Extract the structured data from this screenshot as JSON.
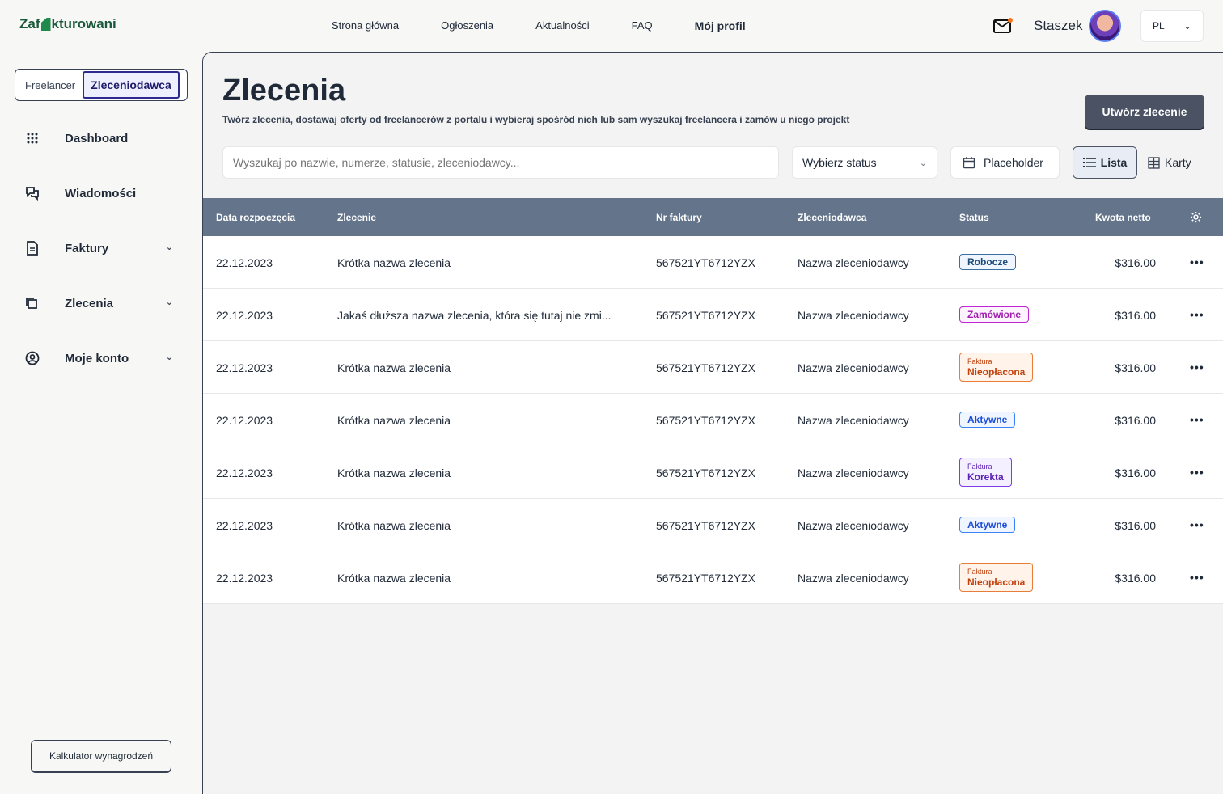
{
  "brand": {
    "logo_left": "Zaf",
    "logo_right": "kturowani"
  },
  "nav": {
    "items": [
      "Strona główna",
      "Ogłoszenia",
      "Aktualności",
      "FAQ"
    ],
    "profile": "Mój profil"
  },
  "user": {
    "name": "Staszek"
  },
  "lang": {
    "value": "PL"
  },
  "sidebar": {
    "role_freelancer": "Freelancer",
    "role_client": "Zleceniodawca",
    "items": [
      {
        "label": "Dashboard"
      },
      {
        "label": "Wiadomości"
      },
      {
        "label": "Faktury"
      },
      {
        "label": "Zlecenia"
      },
      {
        "label": "Moje konto"
      }
    ],
    "calculator": "Kalkulator wynagrodzeń"
  },
  "page": {
    "title": "Zlecenia",
    "subtitle": "Twórz zlecenia, dostawaj oferty od freelancerów z portalu i wybieraj spośród nich lub sam wyszukaj freelancera i zamów u niego projekt",
    "create_button": "Utwórz zlecenie"
  },
  "filters": {
    "search_placeholder": "Wyszukaj po nazwie, numerze, statusie, zleceniodawcy...",
    "status_label": "Wybierz status",
    "date_label": "Placeholder",
    "view_list": "Lista",
    "view_cards": "Karty"
  },
  "table": {
    "headers": {
      "date": "Data rozpoczęcia",
      "order": "Zlecenie",
      "invoice": "Nr faktury",
      "client": "Zleceniodawca",
      "status": "Status",
      "amount": "Kwota netto"
    },
    "rows": [
      {
        "date": "22.12.2023",
        "name": "Krótka nazwa zlecenia",
        "invoice": "567521YT6712YZX",
        "client": "Nazwa zleceniodawcy",
        "status_top": "",
        "status": "Robocze",
        "amount": "$316.00"
      },
      {
        "date": "22.12.2023",
        "name": "Jakaś dłuższa nazwa zlecenia, która się tutaj nie zmi...",
        "invoice": "567521YT6712YZX",
        "client": "Nazwa zleceniodawcy",
        "status_top": "",
        "status": "Zamówione",
        "amount": "$316.00"
      },
      {
        "date": "22.12.2023",
        "name": "Krótka nazwa zlecenia",
        "invoice": "567521YT6712YZX",
        "client": "Nazwa zleceniodawcy",
        "status_top": "Faktura",
        "status": "Nieopłacona",
        "amount": "$316.00"
      },
      {
        "date": "22.12.2023",
        "name": "Krótka nazwa zlecenia",
        "invoice": "567521YT6712YZX",
        "client": "Nazwa zleceniodawcy",
        "status_top": "",
        "status": "Aktywne",
        "amount": "$316.00"
      },
      {
        "date": "22.12.2023",
        "name": "Krótka nazwa zlecenia",
        "invoice": "567521YT6712YZX",
        "client": "Nazwa zleceniodawcy",
        "status_top": "Faktura",
        "status": "Korekta",
        "amount": "$316.00"
      },
      {
        "date": "22.12.2023",
        "name": "Krótka nazwa zlecenia",
        "invoice": "567521YT6712YZX",
        "client": "Nazwa zleceniodawcy",
        "status_top": "",
        "status": "Aktywne",
        "amount": "$316.00"
      },
      {
        "date": "22.12.2023",
        "name": "Krótka nazwa zlecenia",
        "invoice": "567521YT6712YZX",
        "client": "Nazwa zleceniodawcy",
        "status_top": "Faktura",
        "status": "Nieopłacona",
        "amount": "$316.00"
      }
    ]
  },
  "colors": {
    "accent_dark": "#4a5263",
    "table_header": "#64748b",
    "brand_green": "#1f8a4c"
  }
}
